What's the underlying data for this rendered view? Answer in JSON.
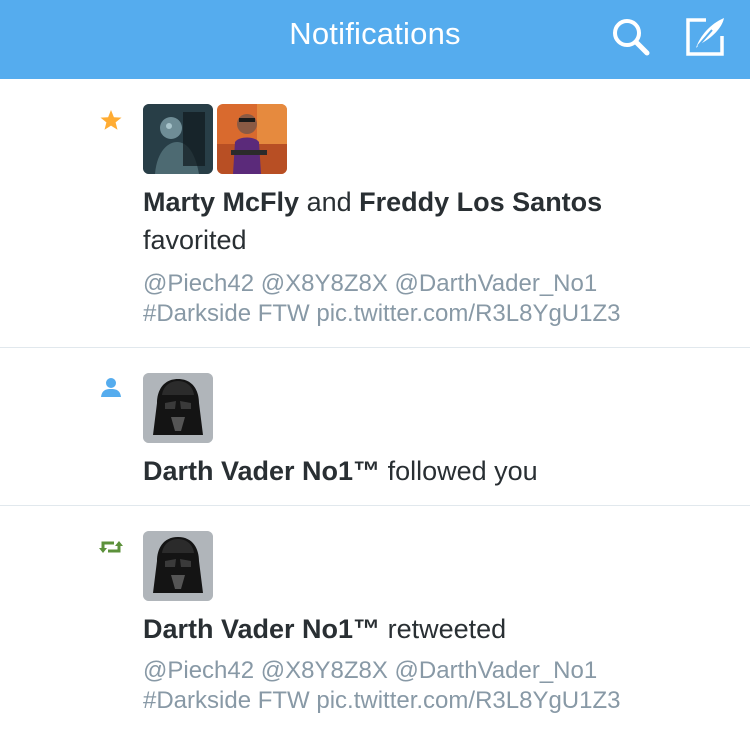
{
  "header": {
    "title": "Notifications",
    "search_icon": "search-icon",
    "compose_icon": "compose-icon",
    "background_color": "#55acee"
  },
  "notifications": [
    {
      "type": "favorite",
      "type_icon": "star-icon",
      "icon_color": "#ffac33",
      "users": [
        "Marty McFly",
        "Freddy Los Santos"
      ],
      "connector": "and",
      "action": "favorited",
      "tweet_lines": [
        "@Piech42 @X8Y8Z8X @DarthVader_No1",
        "#Darkside FTW pic.twitter.com/R3L8YgU1Z3"
      ]
    },
    {
      "type": "follow",
      "type_icon": "person-icon",
      "icon_color": "#55acee",
      "users": [
        "Darth Vader No1™"
      ],
      "action": "followed you"
    },
    {
      "type": "retweet",
      "type_icon": "retweet-icon",
      "icon_color": "#5c913b",
      "users": [
        "Darth Vader No1™"
      ],
      "action": "retweeted",
      "tweet_lines": [
        "@Piech42 @X8Y8Z8X @DarthVader_No1",
        "#Darkside FTW pic.twitter.com/R3L8YgU1Z3"
      ]
    }
  ],
  "colors": {
    "text": "#292f33",
    "tweet_text": "#8899a6",
    "divider": "#e1e8ed"
  }
}
